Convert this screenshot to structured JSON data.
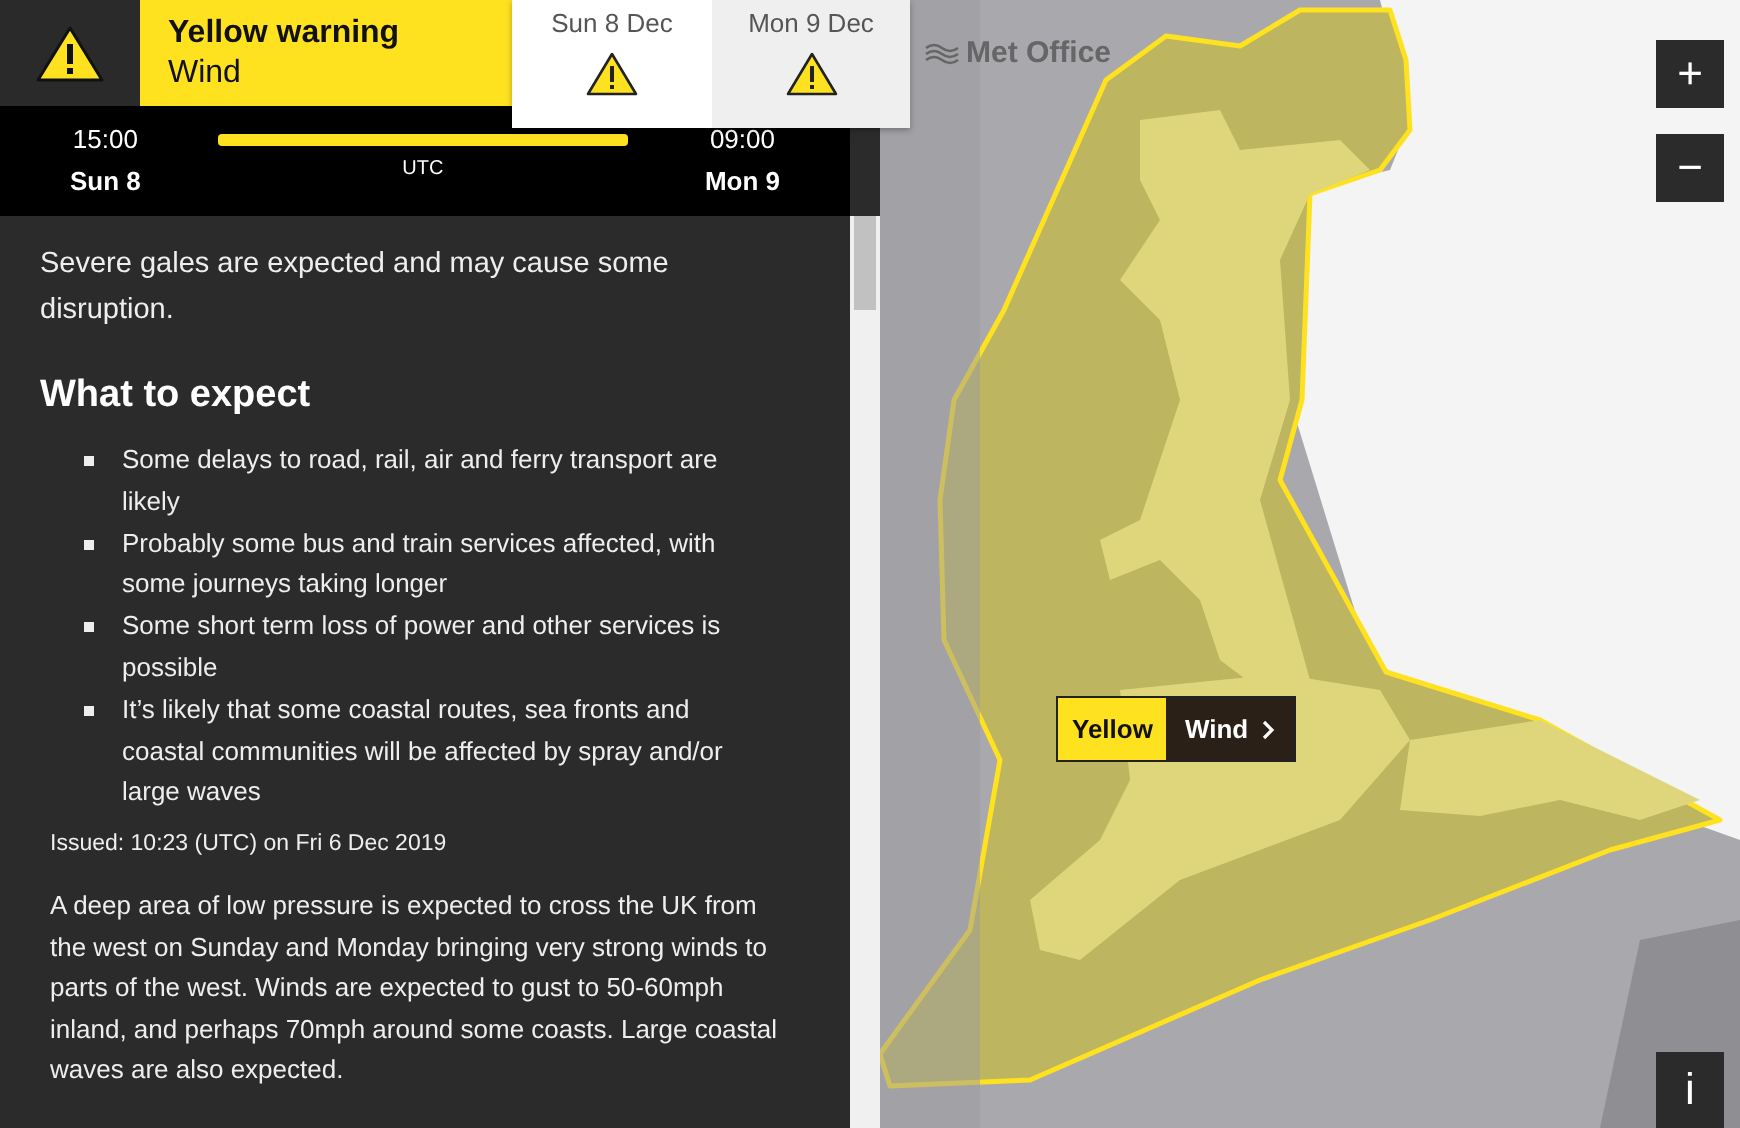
{
  "header": {
    "title": "Yellow warning",
    "subtitle": "Wind"
  },
  "day_tabs": [
    {
      "label": "Sun 8 Dec",
      "selected": true
    },
    {
      "label": "Mon 9 Dec",
      "selected": false
    }
  ],
  "timeline": {
    "start_time": "15:00",
    "start_day": "Sun 8",
    "timezone": "UTC",
    "end_time": "09:00",
    "end_day": "Mon 9"
  },
  "summary": "Severe gales are expected and may cause some disruption.",
  "section_title": "What to expect",
  "expectations": [
    "Some delays to road, rail, air and ferry transport are likely",
    "Probably some bus and train services affected, with some journeys taking longer",
    "Some short term loss of power and other services is possible",
    "It’s likely that some coastal routes, sea fronts and coastal communities will be affected by spray and/or large waves"
  ],
  "issued": "Issued: 10:23 (UTC) on Fri 6 Dec 2019",
  "details": "A deep area of low pressure is expected to cross the UK from the west on Sunday and Monday bringing very strong winds to parts of the west. Winds are expected to gust to 50-60mph inland, and perhaps 70mph around some coasts. Large coastal waves are also expected.",
  "map": {
    "attribution": "Met Office",
    "zoom_in": "+",
    "zoom_out": "−",
    "info": "i",
    "warning_label": {
      "level": "Yellow",
      "type": "Wind"
    }
  }
}
